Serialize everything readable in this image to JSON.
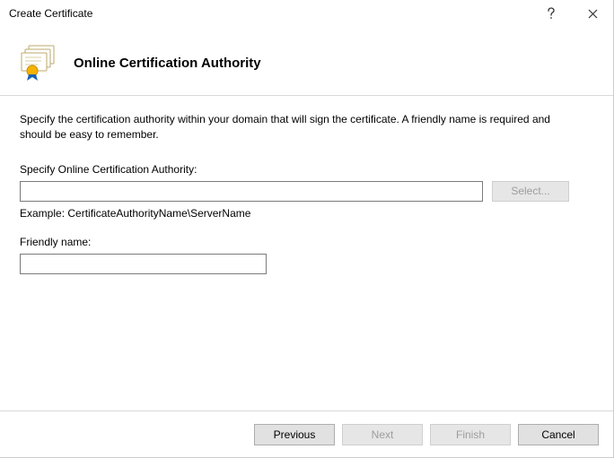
{
  "window": {
    "title": "Create Certificate"
  },
  "header": {
    "heading": "Online Certification Authority"
  },
  "body": {
    "intro": "Specify the certification authority within your domain that will sign the certificate. A friendly name is required and should be easy to remember.",
    "ca_label": "Specify Online Certification Authority:",
    "ca_value": "",
    "select_button": "Select...",
    "example": "Example: CertificateAuthorityName\\ServerName",
    "friendly_label": "Friendly name:",
    "friendly_value": ""
  },
  "footer": {
    "previous": "Previous",
    "next": "Next",
    "finish": "Finish",
    "cancel": "Cancel"
  }
}
